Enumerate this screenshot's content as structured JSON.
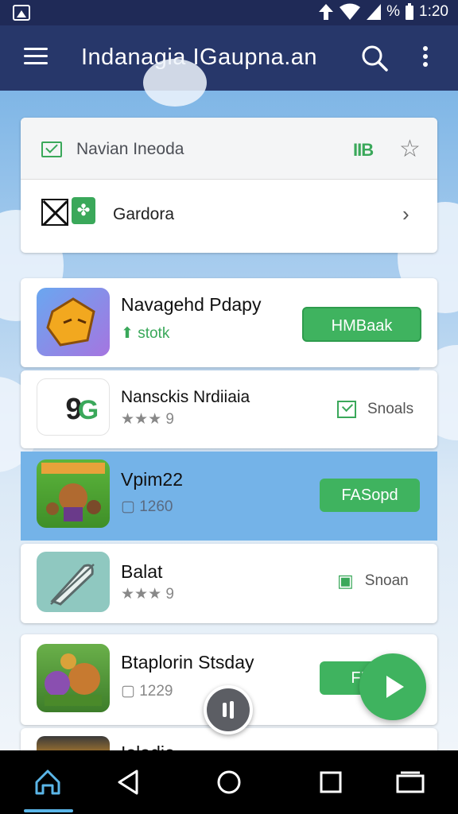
{
  "status_bar": {
    "time": "1:20",
    "battery_label": "%"
  },
  "app_bar": {
    "title": "Indanagia IGaupna.an"
  },
  "top_card": {
    "header_label": "Navian Ineoda",
    "header_action_label": "IIB",
    "row_label": "Gardora"
  },
  "apps": [
    {
      "name": "Navagehd Pdapy",
      "meta": "stotk",
      "button": "HMBaak",
      "style": "filled"
    },
    {
      "name": "Nansckis Nrdiiaia",
      "meta": "★★★ 9",
      "button": "Snoals",
      "style": "outline"
    },
    {
      "name": "Vpim22",
      "meta": "1260",
      "button": "FASopd",
      "style": "filled"
    },
    {
      "name": "Balat",
      "meta": "★★★ 9",
      "button": "Snoan",
      "style": "outline"
    },
    {
      "name": "Btaplorin Stsday",
      "meta": "1229",
      "button": "FIO",
      "style": "filled"
    },
    {
      "name": "Ioladie",
      "meta": "",
      "button": "",
      "style": "none"
    }
  ],
  "colors": {
    "app_bar": "#27376a",
    "status_bar": "#1f2a57",
    "accent_green": "#3fb35f",
    "highlight_row": "#74b3e8"
  },
  "icons": {
    "status_left": "image-icon",
    "status_right": [
      "data-up-arrow-icon",
      "wifi-icon",
      "signal-icon"
    ],
    "app_bar": [
      "menu-icon",
      "search-icon",
      "more-vert-icon"
    ],
    "nav": [
      "home-icon",
      "back-icon",
      "circle-home-icon",
      "square-recents-icon",
      "multiwindow-icon"
    ]
  }
}
